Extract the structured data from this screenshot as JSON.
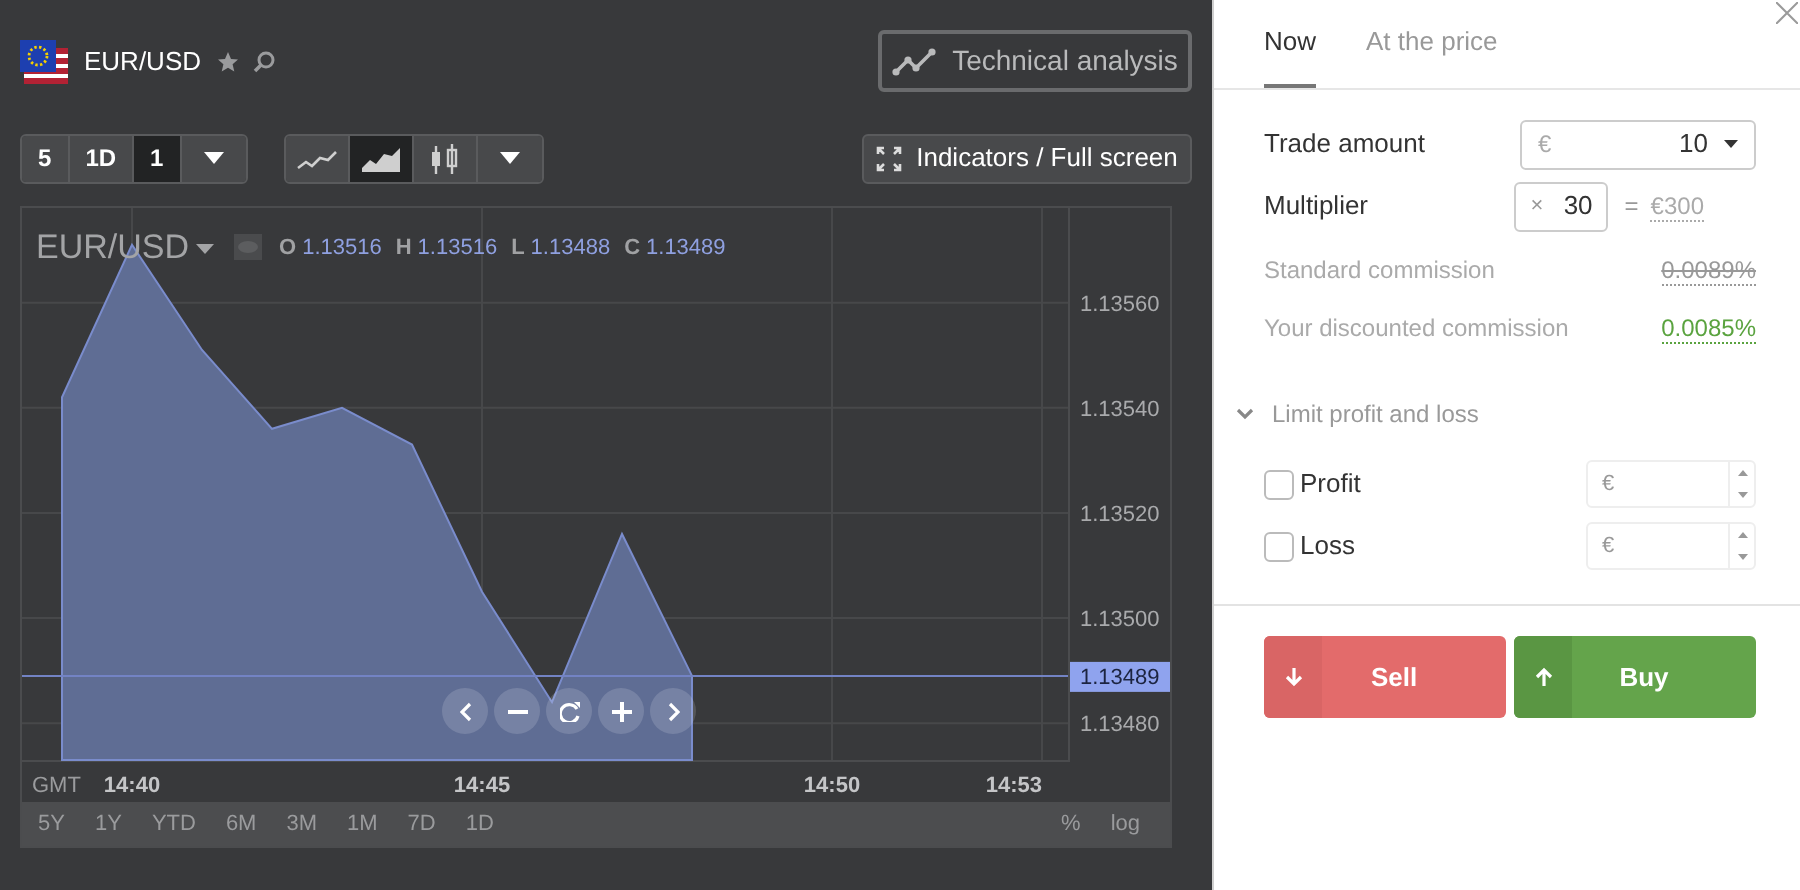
{
  "header": {
    "symbol": "EUR/USD",
    "technical_analysis": "Technical analysis"
  },
  "toolbar": {
    "periods": [
      {
        "label": "5",
        "selected": false
      },
      {
        "label": "1D",
        "selected": false
      },
      {
        "label": "1",
        "selected": true
      }
    ],
    "chart_types": [
      {
        "kind": "line",
        "selected": false
      },
      {
        "kind": "area",
        "selected": true
      },
      {
        "kind": "candles",
        "selected": false
      }
    ],
    "indicators": "Indicators / Full screen"
  },
  "chart": {
    "ohlc": [
      {
        "key": "O",
        "value": "1.13516"
      },
      {
        "key": "H",
        "value": "1.13516"
      },
      {
        "key": "L",
        "value": "1.13488"
      },
      {
        "key": "C",
        "value": "1.13489"
      }
    ],
    "timezone": "GMT",
    "chart_data": {
      "type": "area",
      "categories": [
        null,
        "14:40",
        null,
        null,
        null,
        null,
        "14:45",
        null,
        null,
        null,
        null,
        "14:50",
        null,
        null,
        "14:53"
      ],
      "grid": true,
      "ref_lines": [
        {
          "axis": "y",
          "value": 1.13489,
          "label": "1.13489"
        }
      ],
      "series": [
        {
          "name": "EUR/USD",
          "color": "#5f6d94",
          "values": [
            1.13542,
            1.13571,
            1.13551,
            1.13536,
            1.1354,
            1.13533,
            1.13505,
            1.13484,
            1.13516,
            1.13489,
            null,
            null,
            null,
            null,
            null
          ]
        }
      ],
      "ylim": [
        1.13473,
        1.13578
      ],
      "yticks": [
        {
          "value": 1.1348,
          "label": "1.13480"
        },
        {
          "value": 1.135,
          "label": "1.13500"
        },
        {
          "value": 1.1352,
          "label": "1.13520"
        },
        {
          "value": 1.1354,
          "label": "1.13540"
        },
        {
          "value": 1.1356,
          "label": "1.13560"
        }
      ]
    }
  },
  "ranges": [
    "5Y",
    "1Y",
    "YTD",
    "6M",
    "3M",
    "1M",
    "7D",
    "1D"
  ],
  "scale_options": [
    "%",
    "log"
  ],
  "order": {
    "tabs": [
      {
        "label": "Now",
        "selected": true
      },
      {
        "label": "At the price",
        "selected": false
      }
    ],
    "trade_amount": {
      "label": "Trade amount",
      "currency": "€",
      "value": "10"
    },
    "multiplier": {
      "label": "Multiplier",
      "prefix": "×",
      "value": "30",
      "equals": "=",
      "total": "€300"
    },
    "commissions": [
      {
        "kind": "standard",
        "label": "Standard commission",
        "value": "0.0089%"
      },
      {
        "kind": "discounted",
        "label": "Your discounted commission",
        "value": "0.0085%"
      }
    ],
    "limits": {
      "label": "Limit profit and loss",
      "expanded": true,
      "items": [
        {
          "label": "Profit",
          "checked": false,
          "placeholder": "€"
        },
        {
          "label": "Loss",
          "checked": false,
          "placeholder": "€"
        }
      ]
    },
    "actions": [
      {
        "kind": "sell",
        "label": "Sell"
      },
      {
        "kind": "buy",
        "label": "Buy"
      }
    ]
  }
}
